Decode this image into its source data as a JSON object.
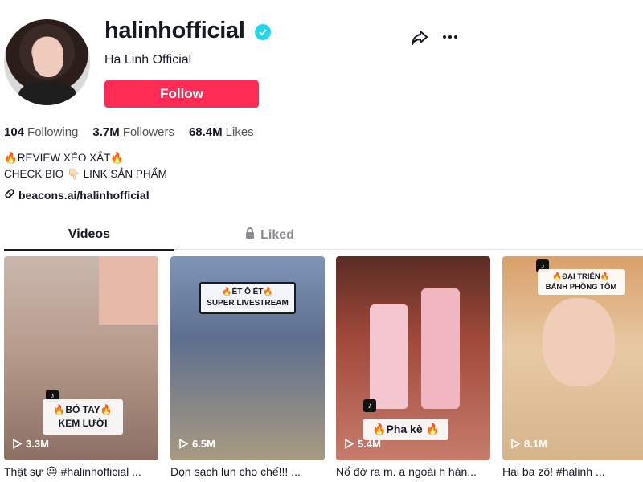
{
  "profile": {
    "username": "halinhofficial",
    "nickname": "Ha Linh Official",
    "follow_label": "Follow",
    "verified": true
  },
  "stats": {
    "following_count": "104",
    "following_label": "Following",
    "followers_count": "3.7M",
    "followers_label": "Followers",
    "likes_count": "68.4M",
    "likes_label": "Likes"
  },
  "bio": {
    "line1": "🔥REVIEW XÉO XẮT🔥",
    "line2": "CHECK BIO 👇🏻 LINK SẢN PHẨM",
    "link": "beacons.ai/halinhofficial"
  },
  "tabs": {
    "videos": "Videos",
    "liked": "Liked"
  },
  "videos": [
    {
      "views": "3.3M",
      "overlay": "🔥BÓ TAY🔥\nKEM LƯỜI",
      "title": "Thật sự 😐 #halinhofficial ..."
    },
    {
      "views": "6.5M",
      "overlay_top": "🔥ÉT Ô ÉT🔥",
      "overlay_bottom": "SUPER LIVESTREAM",
      "title": "Dọn sạch lun cho chế!!! ..."
    },
    {
      "views": "5.4M",
      "overlay": "🔥Pha kè 🔥",
      "title": "Nổ đờ ra m. a ngoài h hàn..."
    },
    {
      "views": "8.1M",
      "overlay_top": "🔥ĐẠI TRIỂN🔥",
      "overlay_bottom": "BÁNH PHỒNG TÔM",
      "title": "Hai ba zô! #halinh ..."
    }
  ],
  "colors": {
    "accent": "#fe2c55",
    "verified": "#20d5ec"
  },
  "icons": [
    "verified-icon",
    "share-icon",
    "more-icon",
    "link-icon",
    "lock-icon",
    "play-icon",
    "tiktok-logo-icon"
  ]
}
